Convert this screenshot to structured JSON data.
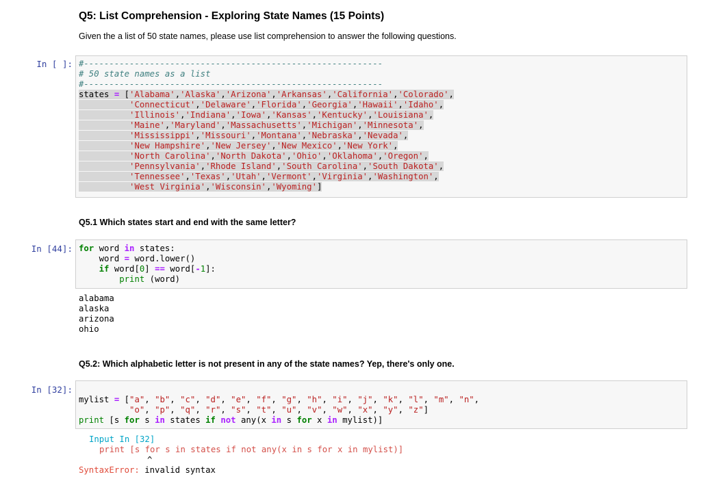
{
  "title": "Q5: List Comprehension - Exploring State Names (15 Points)",
  "intro": "Given the a list of 50 state names, please use list comprehension to answer the following questions.",
  "cells": [
    {
      "prompt": "In [ ]:",
      "lines": [
        "#-----------------------------------------------------------",
        "# 50 state names as a list",
        "#-----------------------------------------------------------",
        "states = ['Alabama','Alaska','Arizona','Arkansas','California','Colorado',",
        "          'Connecticut','Delaware','Florida','Georgia','Hawaii','Idaho',",
        "          'Illinois','Indiana','Iowa','Kansas','Kentucky','Louisiana',",
        "          'Maine','Maryland','Massachusetts','Michigan','Minnesota',",
        "          'Mississippi','Missouri','Montana','Nebraska','Nevada',",
        "          'New Hampshire','New Jersey','New Mexico','New York',",
        "          'North Carolina','North Dakota','Ohio','Oklahoma','Oregon',",
        "          'Pennsylvania','Rhode Island','South Carolina','South Dakota',",
        "          'Tennessee','Texas','Utah','Vermont','Virginia','Washington',",
        "          'West Virginia','Wisconsin','Wyoming']"
      ]
    },
    {
      "prompt": "In [44]:",
      "lines": [
        "for word in states:",
        "    word = word.lower()",
        "    if word[0] == word[-1]:",
        "        print (word)"
      ],
      "output": [
        "alabama",
        "alaska",
        "arizona",
        "ohio"
      ]
    },
    {
      "prompt": "In [32]:",
      "lines": [
        "",
        "mylist = [\"a\", \"b\", \"c\", \"d\", \"e\", \"f\", \"g\", \"h\", \"i\", \"j\", \"k\", \"l\", \"m\", \"n\",",
        "          \"o\", \"p\", \"q\", \"r\", \"s\", \"t\", \"u\", \"v\", \"w\", \"x\", \"y\", \"z\"]",
        "print [s for s in states if not any(x in s for x in mylist)]"
      ],
      "error": {
        "input_line": "Input In [32]",
        "code_line": "print [s for s in states if not any(x in s for x in mylist)]",
        "caret": "^",
        "error_name": "SyntaxError:",
        "error_msg": "invalid syntax"
      }
    }
  ],
  "questions": {
    "q51": "Q5.1 Which states start and end with the same letter?",
    "q52": "Q5.2: Which alphabetic letter is not present in any of the state names? Yep, there's only one."
  }
}
